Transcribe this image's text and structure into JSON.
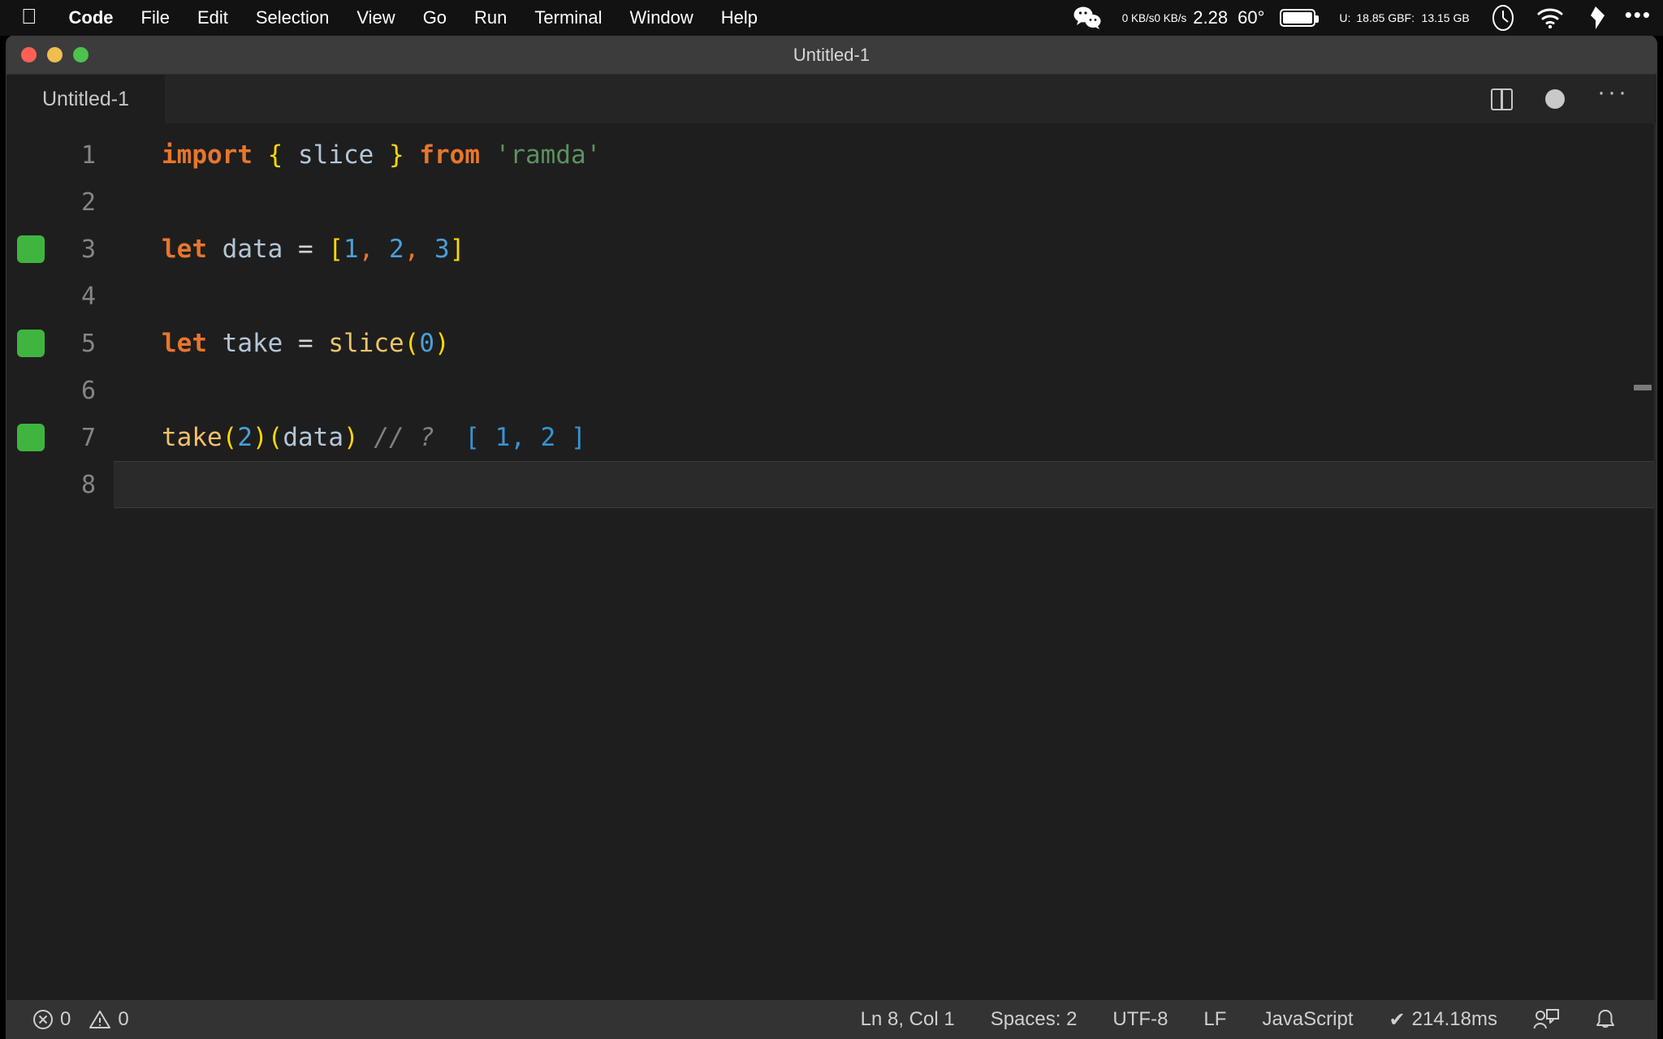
{
  "menubar": {
    "apple_icon": "apple-icon",
    "items": [
      {
        "label": "Code",
        "bold": true
      },
      {
        "label": "File",
        "bold": false
      },
      {
        "label": "Edit",
        "bold": false
      },
      {
        "label": "Selection",
        "bold": false
      },
      {
        "label": "View",
        "bold": false
      },
      {
        "label": "Go",
        "bold": false
      },
      {
        "label": "Run",
        "bold": false
      },
      {
        "label": "Terminal",
        "bold": false
      },
      {
        "label": "Window",
        "bold": false
      },
      {
        "label": "Help",
        "bold": false
      }
    ],
    "tray": {
      "wechat_icon": "wechat-icon",
      "net_up": "0 KB/s",
      "net_down": "0 KB/s",
      "cpu_load": "2.28",
      "temperature": "60°",
      "battery_icon": "battery-icon",
      "mem_used_label": "U:",
      "mem_used_value": "18.85 GB",
      "mem_free_label": "F:",
      "mem_free_value": "13.15 GB",
      "clock_icon": "clock-icon",
      "wifi_icon": "wifi-icon",
      "flag_icon": "input-source-icon",
      "more_icon": "control-center-icon"
    }
  },
  "window": {
    "title": "Untitled-1",
    "traffic_lights": [
      "close-button",
      "minimize-button",
      "zoom-button"
    ]
  },
  "tabbar": {
    "tabs": [
      {
        "label": "Untitled-1",
        "active": true
      }
    ],
    "actions": {
      "split_editor": "split-editor-icon",
      "unsaved_indicator": "unsaved-dot",
      "more_actions": "···"
    }
  },
  "editor": {
    "lines": [
      {
        "number": "1",
        "marker": false,
        "active": false,
        "tokens": [
          {
            "t": "import",
            "c": "kw"
          },
          {
            "t": " ",
            "c": "punc"
          },
          {
            "t": "{",
            "c": "brace"
          },
          {
            "t": " ",
            "c": "punc"
          },
          {
            "t": "slice",
            "c": "varname"
          },
          {
            "t": " ",
            "c": "punc"
          },
          {
            "t": "}",
            "c": "brace"
          },
          {
            "t": " ",
            "c": "punc"
          },
          {
            "t": "from",
            "c": "kw"
          },
          {
            "t": " ",
            "c": "punc"
          },
          {
            "t": "'ramda'",
            "c": "str"
          }
        ]
      },
      {
        "number": "2",
        "marker": false,
        "active": false,
        "tokens": []
      },
      {
        "number": "3",
        "marker": true,
        "active": false,
        "tokens": [
          {
            "t": "let",
            "c": "kw"
          },
          {
            "t": " ",
            "c": "punc"
          },
          {
            "t": "data",
            "c": "varname"
          },
          {
            "t": " ",
            "c": "punc"
          },
          {
            "t": "=",
            "c": "punc"
          },
          {
            "t": " ",
            "c": "punc"
          },
          {
            "t": "[",
            "c": "brace"
          },
          {
            "t": "1",
            "c": "num"
          },
          {
            "t": ",",
            "c": "comma"
          },
          {
            "t": " ",
            "c": "punc"
          },
          {
            "t": "2",
            "c": "num"
          },
          {
            "t": ",",
            "c": "comma"
          },
          {
            "t": " ",
            "c": "punc"
          },
          {
            "t": "3",
            "c": "num"
          },
          {
            "t": "]",
            "c": "brace"
          }
        ]
      },
      {
        "number": "4",
        "marker": false,
        "active": false,
        "tokens": []
      },
      {
        "number": "5",
        "marker": true,
        "active": false,
        "tokens": [
          {
            "t": "let",
            "c": "kw"
          },
          {
            "t": " ",
            "c": "punc"
          },
          {
            "t": "take",
            "c": "varname"
          },
          {
            "t": " ",
            "c": "punc"
          },
          {
            "t": "=",
            "c": "punc"
          },
          {
            "t": " ",
            "c": "punc"
          },
          {
            "t": "slice",
            "c": "fn"
          },
          {
            "t": "(",
            "c": "paren"
          },
          {
            "t": "0",
            "c": "num"
          },
          {
            "t": ")",
            "c": "paren"
          }
        ]
      },
      {
        "number": "6",
        "marker": false,
        "active": false,
        "tokens": []
      },
      {
        "number": "7",
        "marker": true,
        "active": false,
        "tokens": [
          {
            "t": "take",
            "c": "fn2"
          },
          {
            "t": "(",
            "c": "paren"
          },
          {
            "t": "2",
            "c": "num"
          },
          {
            "t": ")",
            "c": "paren"
          },
          {
            "t": "(",
            "c": "paren"
          },
          {
            "t": "data",
            "c": "varname"
          },
          {
            "t": ")",
            "c": "paren"
          },
          {
            "t": " ",
            "c": "punc"
          },
          {
            "t": "// ?",
            "c": "cmt"
          },
          {
            "t": "  ",
            "c": "punc"
          },
          {
            "t": "[ 1, 2 ]",
            "c": "result"
          }
        ]
      },
      {
        "number": "8",
        "marker": false,
        "active": true,
        "tokens": []
      }
    ],
    "source_text": "import { slice } from 'ramda'\n\nlet data = [1, 2, 3]\n\nlet take = slice(0)\n\ntake(2)(data) // ?  [ 1, 2 ]\n",
    "language_result_annotation": "[ 1, 2 ]"
  },
  "statusbar": {
    "errors_icon": "error-circle-icon",
    "errors_count": "0",
    "warnings_icon": "warning-triangle-icon",
    "warnings_count": "0",
    "cursor_position": "Ln 8, Col 1",
    "indentation": "Spaces: 2",
    "encoding": "UTF-8",
    "eol": "LF",
    "language_mode": "JavaScript",
    "run_status_icon": "✔",
    "run_time": "214.18ms",
    "live_share_icon": "live-share-icon",
    "notifications_icon": "bell-icon"
  },
  "colors": {
    "menubar_bg": "#121212",
    "titlebar_bg": "#3c3c3c",
    "tabbar_bg": "#252526",
    "editor_bg": "#1e1e1e",
    "statusbar_bg": "#333333",
    "marker_green": "#3fb53f",
    "keyword_orange": "#e8762c",
    "bracket_yellow": "#ffd700",
    "number_blue": "#4a9fd8",
    "string_green": "#5d9160",
    "result_blue": "#3794d4",
    "comment_gray": "#7f7f7f"
  }
}
